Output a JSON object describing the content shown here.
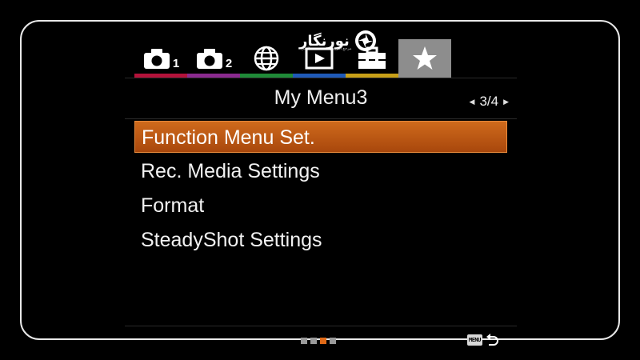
{
  "logo": {
    "text": "نورنگار",
    "subtitle": "مرجع آموزش تخصصی عکاسی"
  },
  "tabs": [
    {
      "icon": "camera-icon",
      "number": "1",
      "color": "#b3123a"
    },
    {
      "icon": "camera-icon",
      "number": "2",
      "color": "#8a2a8f"
    },
    {
      "icon": "globe-icon",
      "number": "",
      "color": "#1f8a38"
    },
    {
      "icon": "playback-icon",
      "number": "",
      "color": "#1f5ab8"
    },
    {
      "icon": "toolbox-icon",
      "number": "",
      "color": "#c8a018"
    },
    {
      "icon": "star-icon",
      "number": "",
      "color": "#8d8d8d",
      "active": true
    }
  ],
  "header": {
    "title": "My Menu3",
    "page": "3/4"
  },
  "menu": {
    "items": [
      {
        "label": "Function Menu Set.",
        "selected": true
      },
      {
        "label": "Rec. Media Settings"
      },
      {
        "label": "Format"
      },
      {
        "label": "SteadyShot Settings"
      }
    ]
  },
  "footer": {
    "menu_key": "MENU",
    "pager_active_index": 2,
    "pager_count": 4
  },
  "colors": {
    "selection": "#c25e17",
    "background": "#000000"
  }
}
